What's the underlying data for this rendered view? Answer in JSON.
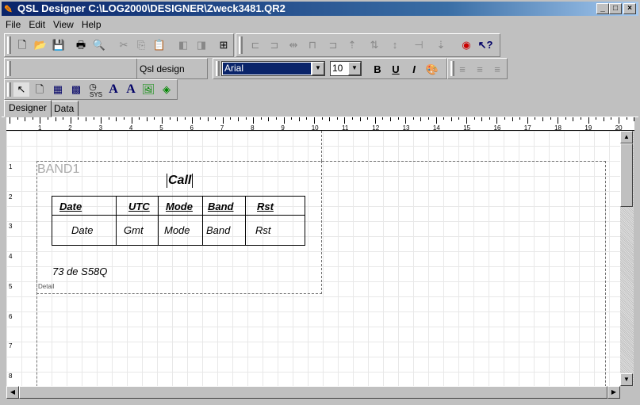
{
  "window": {
    "title": "QSL Designer C:\\LOG2000\\DESIGNER\\Zweck3481.QR2"
  },
  "menu": [
    "File",
    "Edit",
    "View",
    "Help"
  ],
  "format_bar": {
    "style_label": "Qsl design",
    "font": "Arial",
    "size": "10",
    "bold": "B",
    "underline": "U",
    "italic": "I"
  },
  "tabs": [
    "Designer",
    "Data"
  ],
  "ruler": [
    "1",
    "2",
    "3",
    "4",
    "5",
    "6",
    "7",
    "8",
    "9",
    "10",
    "11",
    "12",
    "13",
    "14",
    "15",
    "16",
    "17",
    "18",
    "19",
    "20"
  ],
  "rows": [
    "1",
    "2",
    "3",
    "4",
    "5",
    "6",
    "7",
    "8"
  ],
  "report": {
    "band_title": "BAND1",
    "band_label": "Detail",
    "call": "Call",
    "headers": [
      "Date",
      "UTC",
      "Mode",
      "Band",
      "Rst"
    ],
    "fields": [
      "Date",
      "Gmt",
      "Mode",
      "Band",
      "Rst"
    ],
    "footer": "73 de S58Q"
  },
  "toolbox": {
    "sys_label": "SYS"
  }
}
